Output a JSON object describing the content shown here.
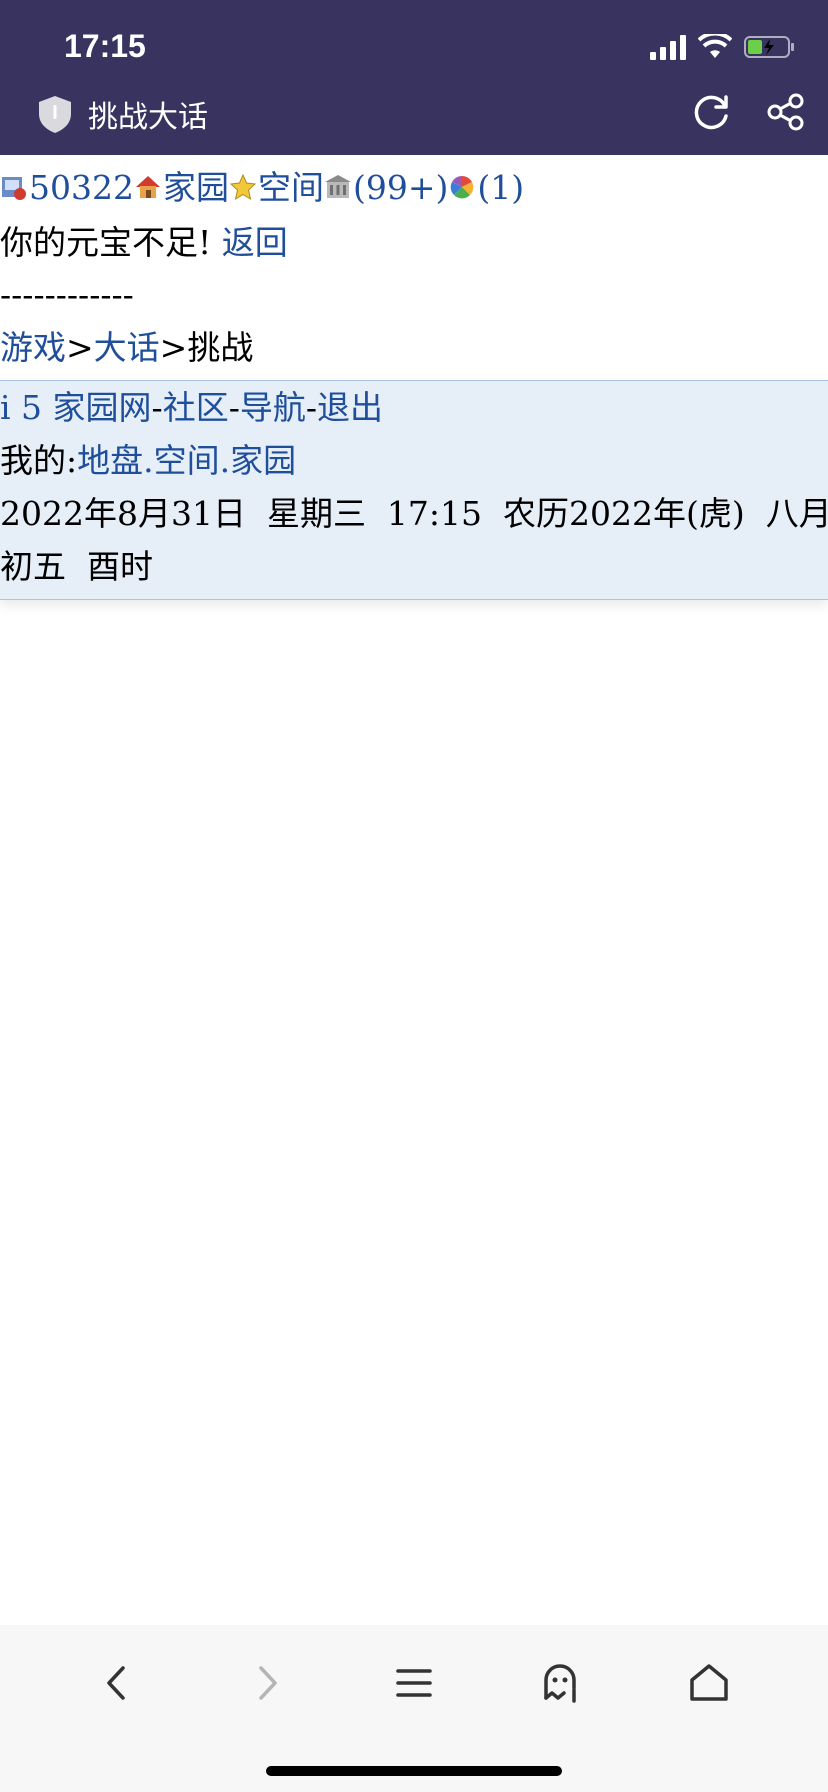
{
  "status_bar": {
    "time": "17:15"
  },
  "header": {
    "title": "挑战大话",
    "icons": [
      "shield-icon",
      "refresh-icon",
      "share-icon"
    ]
  },
  "top_links": {
    "id": "50322",
    "home": "家园",
    "space": "空间",
    "count1": "(99+)",
    "count2": "(1)"
  },
  "message": {
    "text": "你的元宝不足!",
    "back": "返回"
  },
  "separator": "------------",
  "breadcrumb": {
    "game": "游戏",
    "sep1": ">",
    "dahua": "大话",
    "sep2": ">",
    "current": "挑战"
  },
  "footer": {
    "site": "i 5 家园网",
    "dash1": "-",
    "community": "社区",
    "dash2": "-",
    "nav": "导航",
    "dash3": "-",
    "logout": "退出",
    "my_label": "我的:",
    "territory": "地盘",
    "dot1": ".",
    "space": "空间",
    "dot2": ".",
    "home": "家园",
    "date_line1": "2022年8月31日  星期三  17:15  农历2022年(虎)  八月",
    "date_line2": "初五  酉时"
  },
  "bottom_nav": [
    "back-icon",
    "forward-icon",
    "menu-icon",
    "ghost-icon",
    "home-icon"
  ],
  "colors": {
    "header_bg": "#38335f",
    "link": "#1f4e9b",
    "footer_bg": "#e6eef8"
  }
}
